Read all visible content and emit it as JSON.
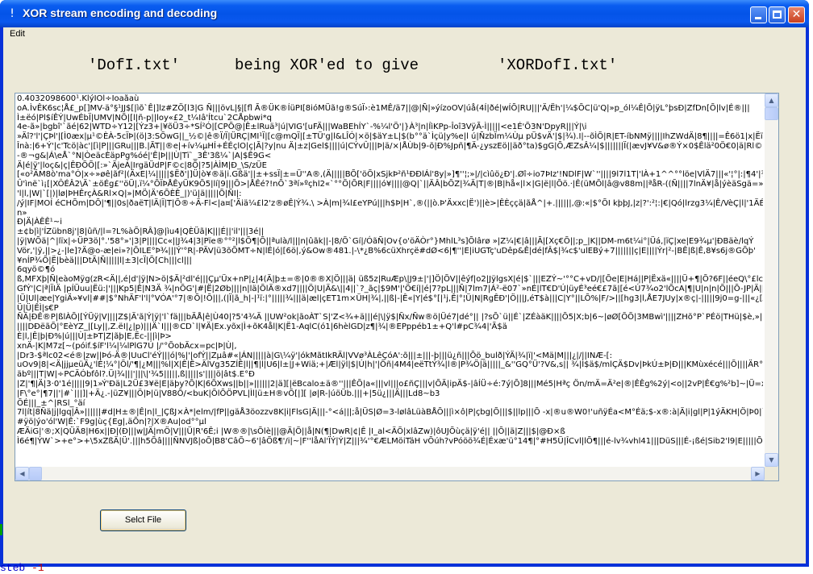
{
  "window": {
    "title": "XOR stream encoding and decoding",
    "icon": "exclamation-icon",
    "accent": "#0454e8"
  },
  "menu": {
    "items": [
      "Edit"
    ]
  },
  "heading": {
    "left": "'DofI.txt'",
    "middle": "being XOR'ed to give",
    "right": "'XORDofI.txt'"
  },
  "output": {
    "lines": [
      "0.4032098600¹.KlýÍÕl÷Ioaåaù",
      "oA.ÌvÊK6sc¦Å£_p[]MV-ä°§¹JJ$[|ìõ`Ê|]lz#ZÖ[l3|G Ñ|||övL|§|[fl Ã®ÜK®ÍüPI[8ióMÜã!g®SúÏ›:è1MÊ/ä7||@|Ñ|»ýízoOV|úå(4Í|ðé|wÍÕ|RU|||'Ä/Ëh'|¼$ÕC|ü'Q|»p_ól¼Ê|Õ|ÿL°þsÐ|ZfDn[Õ|lv|É®|||",
      "Ì±ëó|Pl$íÊÝ|UwÉbÏ|UMV|NÕ|[l|ñ-p||loy«£2_t¼Iâ'Ítcu`2CÅpbwi*q",
      "4e-ã»|bgbî'`ãé|62|WTD÷Y12|[Ýz3+|¥õÜ3÷*SÍ²Ó|[CPÕ@|Ê±lRuä³|ú|VIG'[uFÄ|||WaBEhÍY`-%¼l'Ö'|}À³|n|ÍìKPp-Îoî3VÿÃ-Ì|||||<e1É'Õ3N'DpyR|||Ý|\\i",
      "»Äî?'l'|ÇÞl'|[Ì0æx|µ¹©ÈÀ-5cÏÞ|(ö|3:SÕwG||_½©|ê®Ï/Ï|ÜRÇ|MI¹Ï|[c@mQÏ|[±TÜ'g|l&LÎÓ|×ö|$äY±L|$(b°°ä`Ìçü|y%e|l ú|ÑzbÏm¼Ùµ pÜ$vÄ'|$|¾).I|--õÌÕ|R|ET-íbNMÿ||||IhZWdÄ|8¶||||=Ê6ö1|x|Ëïã-õR",
      "Înà:|6+Ý'|c'Tcö|àc'|[ì|P|||GRu|||B.|ÃT||®e|+ív¼µHÍ+ÉÉçlO|ç|Ã|?y|nu Ä|±z|Gel$||||ú|CÝvÛ|||Þ|ä/×|ÅÙb|9-õ|Ð%Jpñ|¶Ä-¿yszEö||äð°ta)$gG|Õ,ÆZsÂ¼|$|||||||Ï(|ævJ¥V&ø®Ý×0$Êlä²0Ö€0|ä|Rl©|||||+|T|}Jü",
      "-®¬g&|Á\\eÅ`°N|ÒeäcÈäpPg%óé|'Ê|Þ|||Ù|Tï`_3Ê'3ß¼`|A|$Ê9G<",
      "Ä|é|ÿ'|loç&|ç|ÊÐÕÕ|[:»`ÄjeÁ|IrgäÜdP|F©c|8Õ|?5|ÀÌM|Ð_\\S/zÜE",
      "[«o²ÄM8ò'ma°Ó|x÷»øê|ãf²|(ÄxE|¼|||||$Ëð'|]Ü|ò¥®ä|i.Gßä'||±+ssÏ|±=Ü''A®,(Ä|||||BÕ['öÕ|xSjkÞ²ñ¹ÐÐlÁl'8y|»]¶''¦;»|/|cìûö¿Ð'|.Øî÷io7ÞIz'!NDlF|W`''||||9l7l1T|'lÀ+1^^°°löe|VlÄ7|||«'¦°|:|¶4'|¾|||_",
      "Û'ìnë`ì¡[|XÔÉÂ2\\Ä`±öÉg£''öÜ|,ï¼°ÕÏÞÅÊyÜK9Õ5|lí|9|||Õ>|ÅÊé?!nÕ`3ªí»ºçhl2«`°°Õ|ÕR|F||||ó¥||||@Q|`||ÄÂ|bÕZ|¾Ä|T|®|B|hå«|l×|G|ë|l|Õö.·|Ê(üMÕl|â@v88m||ªåR-((Ñ||||7lnÄ¥|å|ýèäSgä=»Õ-|Èú¹",
      "'l|l,|W|`[|)|lø|ÞHÊrçÀ&Rl×Q|»|MÖ|Ä'6ÕÈÊ_|)'ü|ä|||||Õ|ÑI|:",
      "/ý|IF|MOÍ éCHÕm|DÕ|'¶||0s|ðaëT|lÄ|Ï|T|Õ®÷Ä-Fl<|a¤['Äiä¼£l2'z®øÊ|Ý¾.\\ >À|m|¾l£eYPú|||h$Þ|H`,®(||ò.Þ'Äxxc|Ë')||è>|ÊÈççä|ãÅ^|+.||||||,@:«|$°ÕI kþþJ,|z|?':²¦:|€|Qó|lrzg3¼|Ê/VèÇ|l|'1ÄÉÞl|Ê°q|F",
      "n»",
      "Ð|Ä|ÀÊÊ¹~i",
      "±¢b|ì|'ÍZübn8j'|8|ûñ/|l=?L%àÕ|RÂ]@|ìu4|QÈÜã|K|||É||'il'|||3é||",
      "|ÿ|WÕä|^|lïx|÷ÜP3ö|°.'58°»'|3|P||||Cc«||J¾4|3|Pïe®°°²|l$Õ¶|Õ||ªulà/l|||n|ûãk||-|8/Õ`Gí|/ÓãÑ|Ov{o'öÄÒr°}MhlL³s]Õlârø »|Z¼|€|â|||Ã|[Xç€Õ||;p_|K||DM-m6t¼i°|Üá,|ïÇ|xe|E9¾µ'|ÐBäè/lqÝ",
      "Vör,'|ÿ,||>¿-|le]?Ä@o-æ|ei»?|ÕILE°Þ¾|||Ý'°R|-PÄV|ü3õÕMT÷N|lÉ|ó|[6ö|,ý&Ow®481.|-\\*¿B%6cüXhrçë#dØ<6|¶''|E|iUGTç'uDêp&Ê|dé|fÂ$|¾c$'ulEBý+7|||||||ç|E||||Ýr|²-|BÊ|ß|Ê,8¥s6j®GÕþ'",
      "¥nÍP¾Õ|Ë|bèä|||DtÄ|Ñ|||||l|±3|cÏ|Õ[Ch|||cl|||",
      "6qyö©¶ó",
      "ß,MFXþ|Ñ|eàoMÿg(zR<Ä||,é|d'|ÿ|N>ö|$Ä|²dl'é|||Çµ'Üx+nP|¿|4(Ä|þ±=®|0®®X|Ö|||ä| üß5z|RuÆp\\|J9±|'|]Ö|ÕV||êýf|o2|JÿlgsX|é|$`|||EZÝ~'°°C+vD/|[Õe|E|Há||P|Ëxä«||||Ü+¶|Õ?6F||éeQ\\°£lc¾l;Ý|qlÃ",
      "GfÝ'|C|ª|ÏIÄ |pÍÜuu|Ëü:|'|||Kp5|Ê|N3Ä ¾|nÕG'|#|Ë|2Øb||||n|lä|ÕlÄ®xd7||||Ö|U|Ä&\\||4||`?_ãç|$9M'|'Ö€í||é|7?pL|||Ñ|7lm7|Á²-ë07`»nÉ|lT€D'Ú|üyÉ³eé€£7ã|[é<Ú7¾o2'lÕcA|¶|U|n|n|Õ|||Õ-JP|Ä||",
      "|Ü|Ul|æe|YgiÄ»¥vl|##|$°NhÄF'l'l|°VÓA'°7|®Õ|!Õ|||,(|Ï|ã_h|-|¹ï:|°|||||¾|||ä|æl|çET1m×ÜH|¾|,||ß|-|Ê«|Y|é$°[|¹j,Ê|°¦Ü|N|RgÊÐ'|Ö|||J,éT$à|||C|Y°||LÕ%|F/>||[hg3|l,ÅE7JUy|x®ç|-|||||9j0=g-|||«¿[ÄÕ|||AaoUXU",
      "Ü|Ü|ÊÌ|s€P",
      "ÑÄ|ÐÊ®P|ßlÀÕ|[ÝÜÿ|V||||Z$|Ä'ã|Ý|ÿ|'l`fä|||bÄÅ|ê|Ù40|?5'4¾Ä ||UW²ok|ãoÀT`S|'Z<¾+ä|||é|\\|ÿ$|Ñx/Ñw®ö|Üé7|dé°|| |?sÕ`ü||É`|ZÉàäK||||Õ5|X;b|6~|øØ[ÕÕ|3MBwì'||||ZHõ°P`PÉö|THü|$è,»||ÿÄü|k\\°",
      "||||DÐëãÕ|°EèYZ_|[Ly||,Z.ëI|¿|p)|||Ä`I|||®CD`l|¥Ä|Ex.yõx|Ì+õK4ål|K|Ë1-AqlC(ó1|6hèlGD|z¶|¾|®EPppéb1±+Q'l#pC¾4|'Ã$ä",
      "È|l,|Ê|þ|Ð%|ú|||Ù|±ÞT|Z|ãþ|E,Ëc-|||ì|Þ>",
      "xnÄ-|K|M7z[~(póif.$íF'l¼|¼lPlG7Ú |/'°ÕobÄcx=pc|Þ|Ù|,",
      "|Dr3-$ªlc02<é®|zw||Þó-Ä®|UuCl'éÝ|||ó|%|'|ofÝ||Zµâ#«|ÁN|||||à|G\\¼ÿ'|ókMãtIkRÄl|VVø³ÀLêÇóA':õ|||±|||-þ|||ü¿ñ|||Õö_bulð|ÝÄ|¾|ï|'<Mä|M|||¿|/||INÆ-[:",
      "uOv9|8|<Ä|jjµeüÄ¿'lÉ¦¼°|Õl/'¶|¿M|||%l|X|Ê|Ê>ÄlVg35ZÍÊ|l||¶|l|U6|l±|J+Wiä;+|Æl|ÿl|$|Ú|h|'|Õñ|4M4|eëTtÝ¾|l®|P¾Ö|ä|||||_&''GQ°Ü'?V&,s|| ¾|Ì$ä$/mlÇÄ$Dv|ÞkÚ±Þ|Ð|||KMùxécé|||Õ||||ÄR°Ç|||yÞdíl'`%Õ'|||Ë",
      "äbº|||T|W|÷PCÄÓbfôl?.Ü|¾|||'|||\\|'¾5|||||,ß|||||s'||||ö|ât$.E°Ð",
      "|Z|'¶|Ä|3·0'1é|||||9|1»Ý'Ðä|L2Ü£3¥ë|E|äþy?Õ|K|6ÕXws||b||»||||||2|ä][|ëBcalo±ä®''|||ÊÕ|a«|||vl|||o£ñÇ|||v|ÕÄ|ipÄ$-|âÍÜ÷é:7ý|Õ]8|||Mé5|Hªç Ön/mÄ=Ä²e|®|ÊÊg%2ý|<o||2vP|Ê€g%²b]~|Ü=x)",
      "|F\\°e°|¶7||'|#`|||]|+Ä¿.-|üZ¥|||Ö|Þ|ü|V88Õ/<buK|ÕlÕÖPVL|Ìl|ü±H®vÕ[|][ |ø|R-|úöÜb.|||+|5ü¿|||Ä|||Ld8~b3",
      "ÕÉ|||_±^|RSl_°äí",
      "7l|ít|8Ñä|j|lgq|Â»||||||#d|H±®|Ê|n|l_|ÇßJ×À*|elm/|fP||gäÅ3öozzv8K|i|FlsG|Ä|||-°<á|||;å|ÜS|Ø=3-lølâLüàBÅÕ|||ì×ô|P|çbg|Õ|||$||lp|||Õ -x|®u®W0!'uñÿÉa<M°Éä;$-x®:à|Ä|i|gl|P|1ýÄKH|Ö|Þ0|`l×tÇã|lm3",
      "#ÿö|ýo'ól'W|Ê:`F9g|ùç{Eg|,äÕn|?|X®Au|od°°µl",
      "ÆÄiG|'®;X|QÜÄ8|H6x||Ð|(Ð|||w|JÄ|mÖ|V|||Ü|R'6Ê;i |W®®|\\sÕlè|||@Ä|Õ||å|N(¶|DwR|¢|Ê |I_al<ÄÕ|xlâZw)|ôUJÕùçä|ÿ'é|| ||Õ||ä|Z|||$|@Ð×ß",
      "Ì6é¶|ÝW`>+e°>+\\5xZßÄ|Ü'.|||h5Õâ||||ÑNVJß|oÕ|B8'CâÕ~6'|âÕß¶'/i|~|F''låAl'ÏÝ|Ý|Z|||¾'°€ÆLMöiTäH vÕúh?vPóöö¾É|Éxæ'ü°14¶|°#H5Ü|ÎCvl|lÕ¶|||é-lv¾vhl41|||DüS|||É-¡ßé|Sib2'l9|E|||||Õ'fÕ°lÞ°æÎ"
    ]
  },
  "buttons": {
    "select_file": "Selct File"
  },
  "background_text": {
    "left": "steb",
    "right": "-1"
  }
}
